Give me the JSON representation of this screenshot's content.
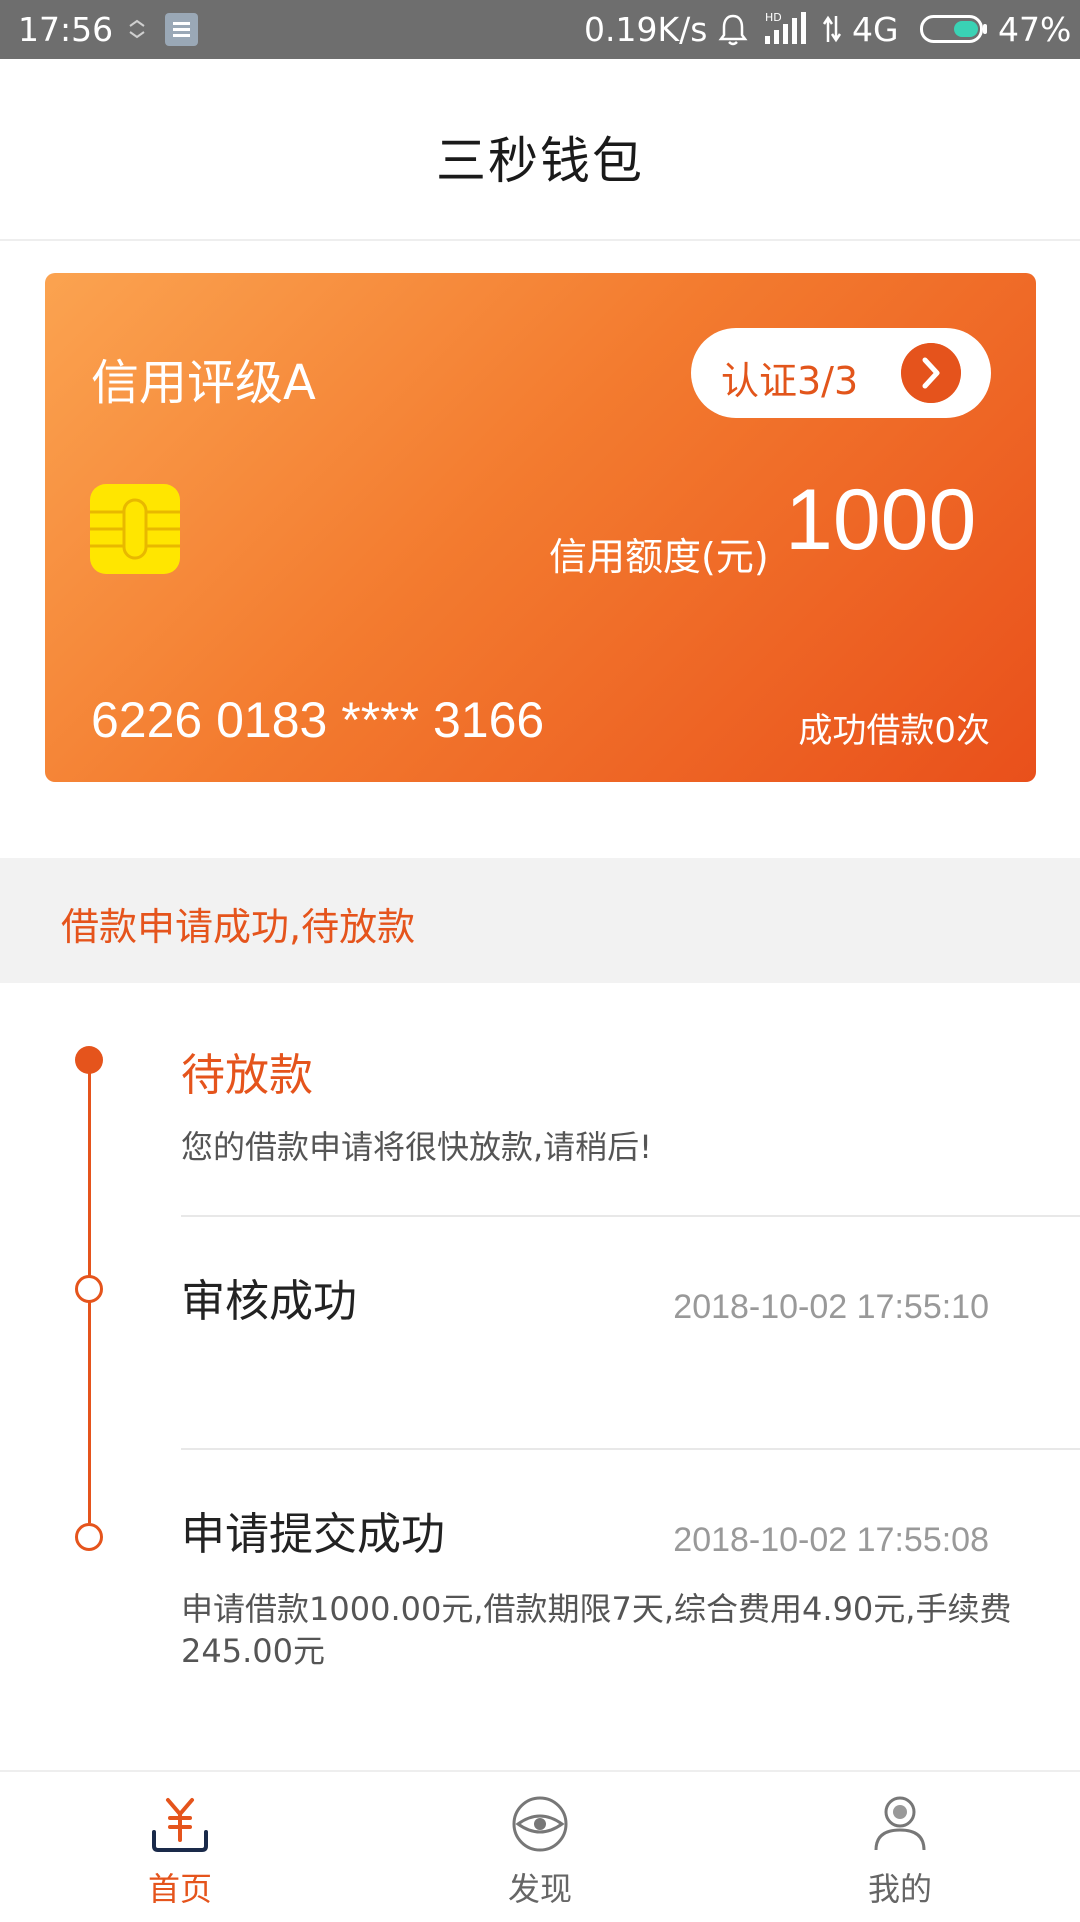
{
  "status_bar": {
    "time": "17:56",
    "speed": "0.19K/s",
    "network": "4G",
    "battery": "47%"
  },
  "header": {
    "title": "三秒钱包"
  },
  "card": {
    "credit_grade": "信用评级A",
    "verify_label": "认证3/3",
    "limit_label": "信用额度(元)",
    "limit_value": "1000",
    "card_number": "6226 0183 **** 3166",
    "loan_count": "成功借款0次"
  },
  "banner": {
    "text": "借款申请成功,待放款"
  },
  "timeline": {
    "steps": [
      {
        "title": "待放款",
        "desc": "您的借款申请将很快放款,请稍后!",
        "time": ""
      },
      {
        "title": "审核成功",
        "desc": "",
        "time": "2018-10-02 17:55:10"
      },
      {
        "title": "申请提交成功",
        "desc": "申请借款1000.00元,借款期限7天,综合费用4.90元,手续费245.00元",
        "time": "2018-10-02 17:55:08"
      }
    ]
  },
  "bottom_nav": {
    "items": [
      {
        "label": "首页",
        "icon": "yen-wallet-icon",
        "active": true
      },
      {
        "label": "发现",
        "icon": "eye-icon",
        "active": false
      },
      {
        "label": "我的",
        "icon": "user-icon",
        "active": false
      }
    ]
  },
  "colors": {
    "accent": "#e5541c",
    "card_gradient_start": "#fba350",
    "card_gradient_end": "#e9501b",
    "chip": "#ffe600"
  }
}
